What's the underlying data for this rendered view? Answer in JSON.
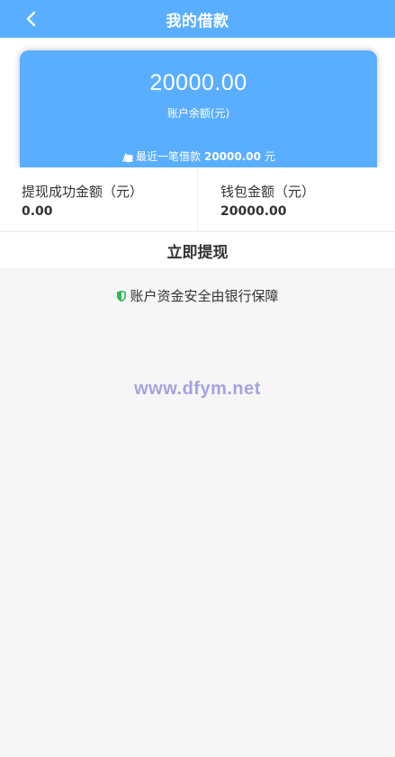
{
  "header": {
    "title": "我的借款",
    "back_icon": "chevron-left-icon"
  },
  "balance_card": {
    "amount": "20000.00",
    "label": "账户余额(元)",
    "recent_prefix": "最近一笔借款",
    "recent_amount": "20000.00",
    "recent_suffix": "元",
    "recent_icon": "coin-stack-icon",
    "bg_color": "#5aaeff"
  },
  "stats": [
    {
      "label": "提现成功金额（元）",
      "value": "0.00"
    },
    {
      "label": "钱包金额（元）",
      "value": "20000.00"
    }
  ],
  "withdraw_button": {
    "label": "立即提现"
  },
  "security_note": {
    "text": "账户资金安全由银行保障",
    "icon": "shield-icon",
    "icon_color": "#2db84d"
  },
  "watermark": {
    "text": "www.dfym.net"
  }
}
